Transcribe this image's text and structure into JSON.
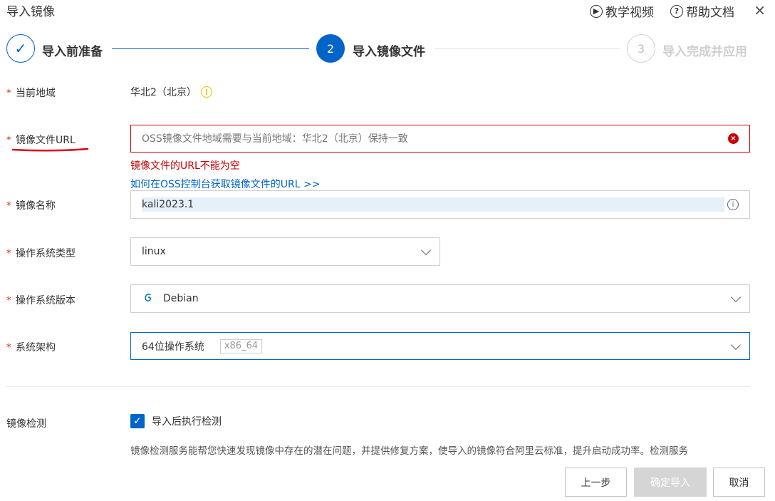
{
  "dialog": {
    "title": "导入镜像",
    "tutorial_video": "教学视频",
    "help_docs": "帮助文档",
    "close": "×"
  },
  "steps": [
    {
      "num": "✓",
      "label": "导入前准备",
      "state": "done"
    },
    {
      "num": "2",
      "label": "导入镜像文件",
      "state": "active"
    },
    {
      "num": "3",
      "label": "导入完成并应用",
      "state": "pending"
    }
  ],
  "form": {
    "region": {
      "label": "当前地域",
      "value": "华北2（北京）"
    },
    "url": {
      "label": "镜像文件URL",
      "placeholder": "OSS镜像文件地域需要与当前地域：华北2（北京）保持一致",
      "value": "",
      "error": "镜像文件的URL不能为空",
      "help_link": "如何在OSS控制台获取镜像文件的URL >>"
    },
    "name": {
      "label": "镜像名称",
      "value": "kali2023.1"
    },
    "os_type": {
      "label": "操作系统类型",
      "value": "linux"
    },
    "os_version": {
      "label": "操作系统版本",
      "value": "Debian"
    },
    "arch": {
      "label": "系统架构",
      "value": "64位操作系统",
      "tag": "x86_64"
    },
    "check": {
      "label": "镜像检测",
      "checkbox_label": "导入后执行检测",
      "checked": true,
      "description": "镜像检测服务能帮您快速发现镜像中存在的潜在问题，并提供修复方案，使导入的镜像符合阿里云标准，提升启动成功率。检测服务"
    }
  },
  "footer": {
    "prev": "上一步",
    "confirm": "确定导入",
    "cancel": "取消"
  },
  "colors": {
    "primary": "#0064c8",
    "error": "#c80000",
    "required": "#e0301e",
    "warning": "#f0c000",
    "disabled_btn": "#d5d5d5"
  }
}
